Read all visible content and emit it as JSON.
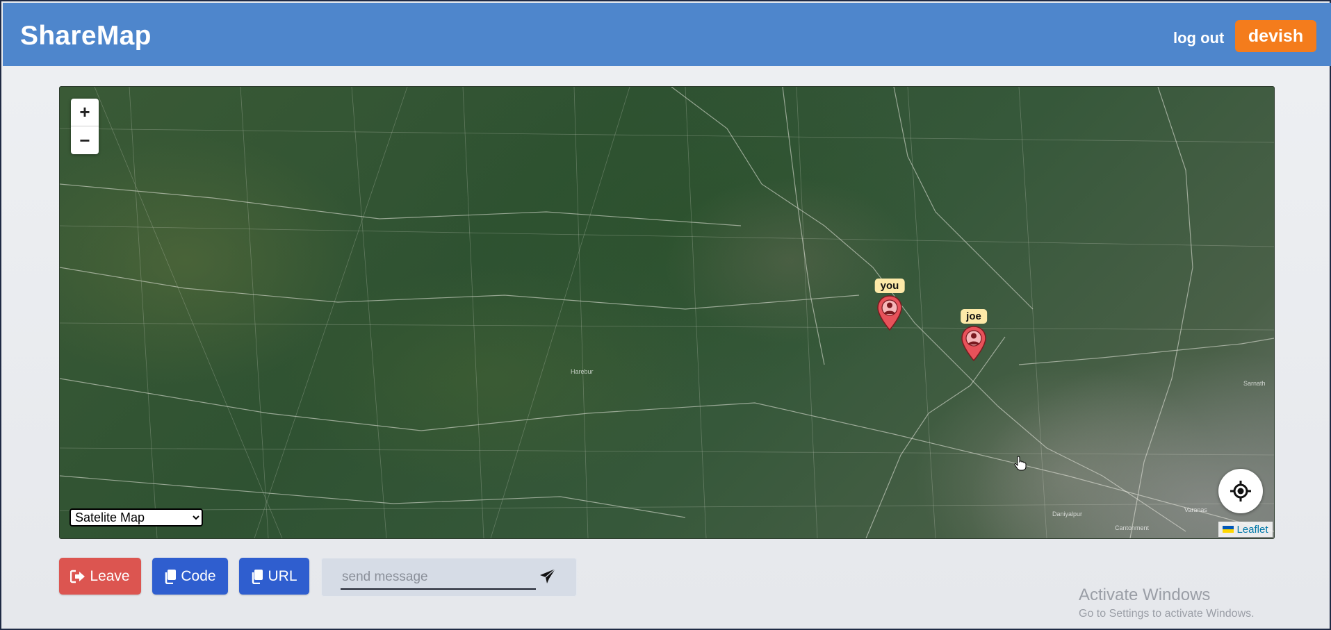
{
  "header": {
    "brand": "ShareMap",
    "logout_label": "log out",
    "user_label": "devish"
  },
  "map": {
    "zoom_in_label": "+",
    "zoom_out_label": "−",
    "layer_select": {
      "selected": "Satelite Map"
    },
    "attribution": "Leaflet",
    "markers": [
      {
        "label": "you"
      },
      {
        "label": "joe"
      }
    ],
    "place_labels": [
      "Harebur",
      "Sarnath",
      "Daniyalpur",
      "Varanas",
      "Cantonment"
    ]
  },
  "controls": {
    "leave_label": "Leave",
    "code_label": "Code",
    "url_label": "URL",
    "message_placeholder": "send message"
  },
  "os_watermark": {
    "title": "Activate Windows",
    "subtitle": "Go to Settings to activate Windows."
  },
  "colors": {
    "header": "#4e86cc",
    "user_button": "#f47c1c",
    "leave_button": "#dc5550",
    "primary_button": "#2f5ecf",
    "marker": "#e8525a"
  }
}
